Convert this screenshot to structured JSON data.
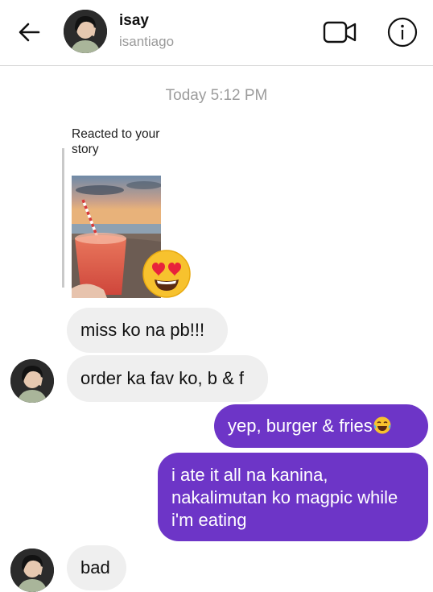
{
  "header": {
    "name": "isay",
    "username": "isantiago"
  },
  "conversation": {
    "timestamp": "Today 5:12 PM",
    "story_reply": {
      "label": "Reacted to your story",
      "reaction": "heart-eyes-emoji"
    },
    "messages": [
      {
        "from": "them",
        "text": "miss ko na pb!!!"
      },
      {
        "from": "them",
        "text": "order ka fav ko, b & f"
      },
      {
        "from": "me",
        "text": "yep, burger & fries",
        "emoji": "laughing-tears-emoji"
      },
      {
        "from": "me",
        "text": "i ate it all na kanina, nakalimutan ko magpic while i'm eating"
      },
      {
        "from": "them",
        "text": "bad"
      }
    ]
  },
  "colors": {
    "outgoing_bubble": "#6d35c7",
    "incoming_bubble": "#efefef",
    "timestamp_text": "#9c9c9c"
  }
}
